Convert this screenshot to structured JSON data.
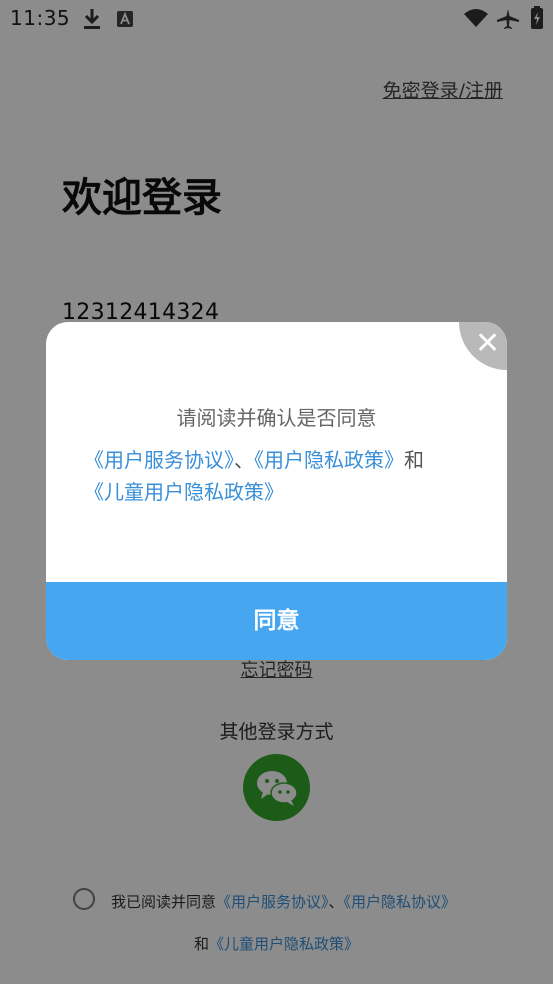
{
  "status_bar": {
    "time": "11:35",
    "icons": [
      "download-icon",
      "a-notification-icon",
      "wifi-icon",
      "airplane-icon",
      "battery-icon"
    ]
  },
  "header": {
    "register_link": "免密登录/注册"
  },
  "main": {
    "title": "欢迎登录",
    "phone_value": "12312414324",
    "forgot_password": "忘记密码",
    "other_login_label": "其他登录方式",
    "wechat_icon": "wechat-icon"
  },
  "footer": {
    "prefix": "我已阅读并同意",
    "service_agreement": "《用户服务协议》",
    "sep": "、",
    "privacy_agreement": "《用户隐私协议》",
    "and": "和",
    "child_privacy": "《儿童用户隐私政策》"
  },
  "dialog": {
    "close_icon": "close-icon",
    "heading": "请阅读并确认是否同意",
    "link_service": "《用户服务协议》",
    "sep": "、",
    "link_privacy": "《用户隐私政策》",
    "and": "和",
    "link_child": "《儿童用户隐私政策》",
    "agree_label": "同意"
  },
  "colors": {
    "accent_blue": "#47a6f0",
    "link_blue": "#3a8fd9",
    "wechat_green": "#35a82d"
  }
}
